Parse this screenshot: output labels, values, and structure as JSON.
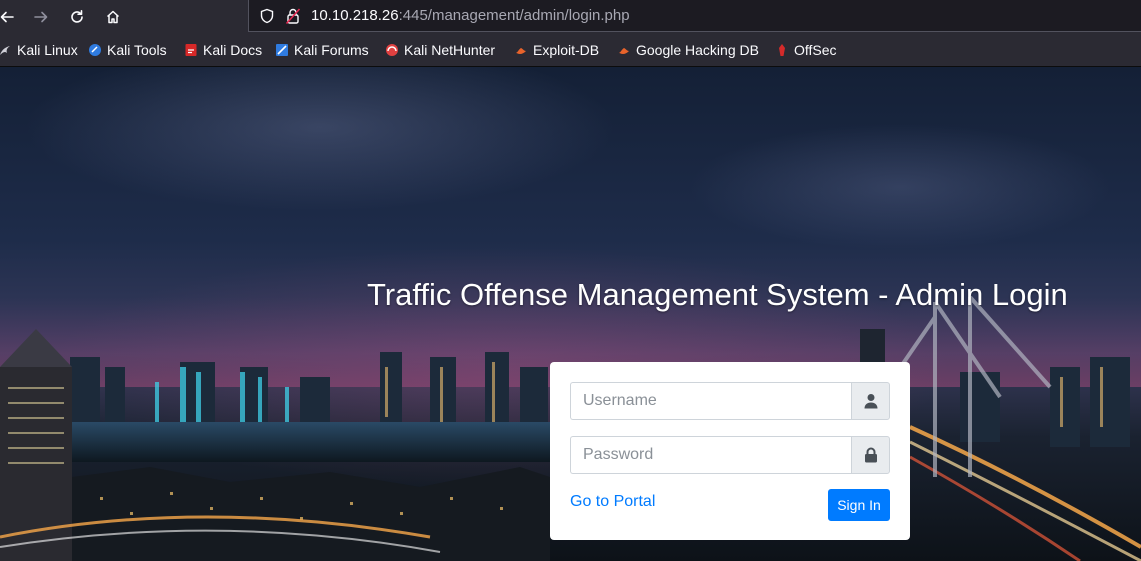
{
  "browser": {
    "url_host": "10.10.218.26",
    "url_rest": ":445/management/admin/login.php"
  },
  "bookmarks": [
    {
      "label": "Kali Linux",
      "icon": "kali-dragon-icon"
    },
    {
      "label": "Kali Tools",
      "icon": "kali-tools-icon"
    },
    {
      "label": "Kali Docs",
      "icon": "kali-docs-icon"
    },
    {
      "label": "Kali Forums",
      "icon": "kali-forums-icon"
    },
    {
      "label": "Kali NetHunter",
      "icon": "nethunter-icon"
    },
    {
      "label": "Exploit-DB",
      "icon": "exploit-db-icon"
    },
    {
      "label": "Google Hacking DB",
      "icon": "ghdb-icon"
    },
    {
      "label": "OffSec",
      "icon": "offsec-icon"
    }
  ],
  "login": {
    "title": "Traffic Offense Management System - Admin Login",
    "username_placeholder": "Username",
    "password_placeholder": "Password",
    "portal_link": "Go to Portal",
    "signin_label": "Sign In"
  },
  "colors": {
    "primary": "#007bff",
    "chrome": "#2b2a33"
  }
}
